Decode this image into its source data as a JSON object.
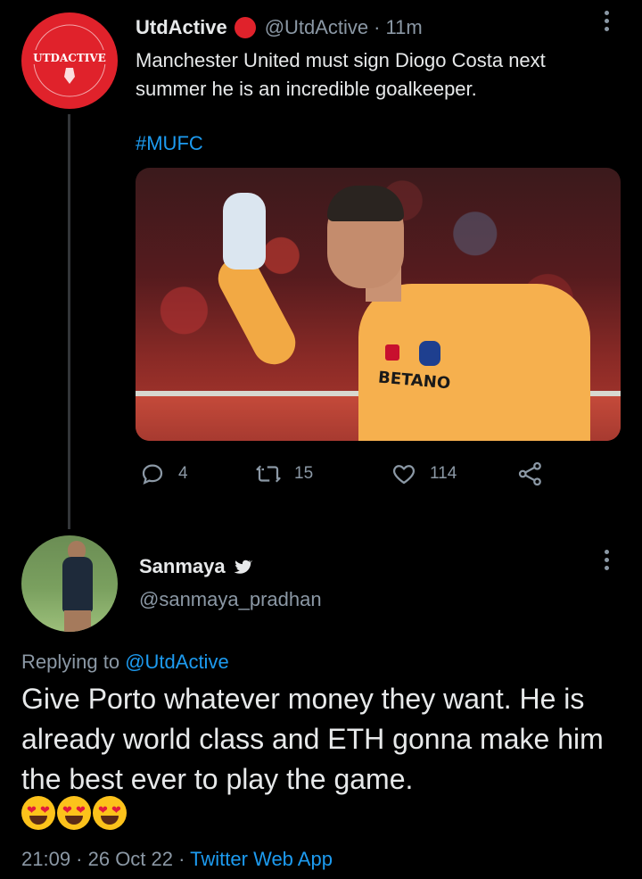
{
  "parent_tweet": {
    "display_name": "UtdActive",
    "handle": "@UtdActive",
    "separator": "·",
    "time": "11m",
    "text": "Manchester United must sign Diogo Costa next summer he is an incredible goalkeeper.",
    "hashtag": "#MUFC",
    "avatar_text": "UTDACTIVE",
    "photo_sponsor": "BETANO",
    "actions": {
      "reply_count": "4",
      "retweet_count": "15",
      "like_count": "114"
    }
  },
  "focus_tweet": {
    "display_name": "Sanmaya",
    "handle": "@sanmaya_pradhan",
    "replying_prefix": "Replying to",
    "replying_to": "@UtdActive",
    "text": "Give Porto whatever money they want. He is already world class and ETH gonna make him the best ever to play the game.",
    "emoji_count": 3,
    "timestamp": "21:09 · 26 Oct 22",
    "meta_sep": "·",
    "source": "Twitter Web App"
  },
  "colors": {
    "background": "#000000",
    "link": "#1d9bf0",
    "muted": "#8b98a5",
    "avatar_red": "#e0222b"
  },
  "icons": [
    "reply-icon",
    "retweet-icon",
    "like-icon",
    "share-icon",
    "twitter-bird-icon",
    "more-options-icon"
  ]
}
